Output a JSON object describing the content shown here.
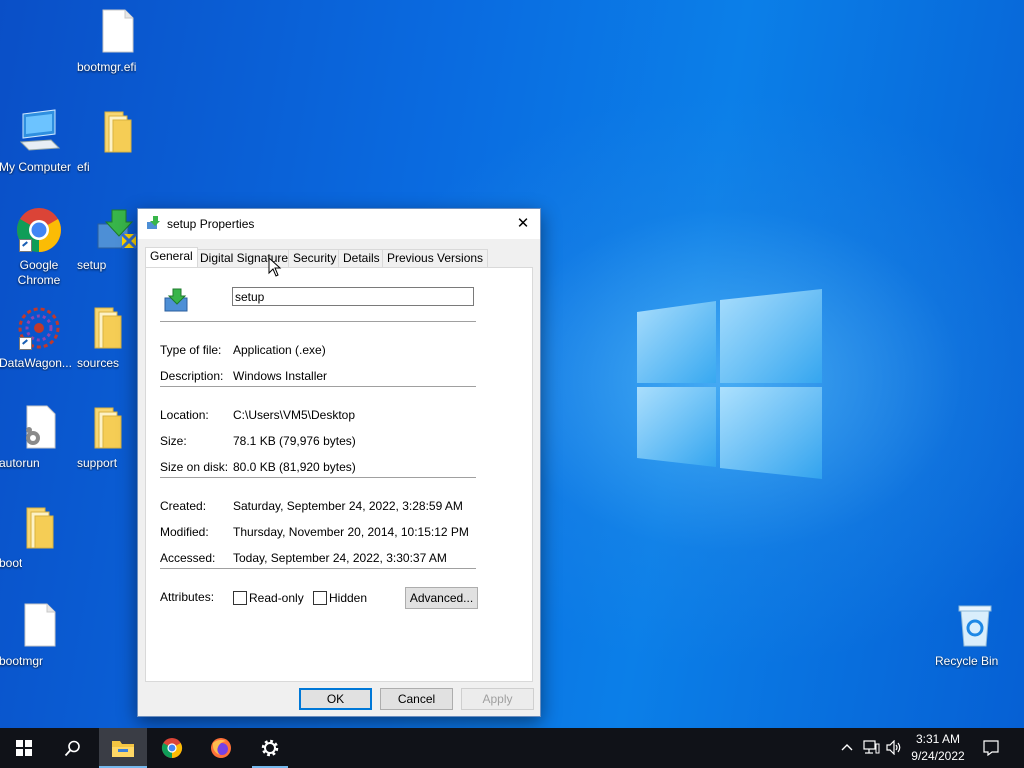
{
  "desktop": {
    "icons": [
      {
        "label": "bootmgr.efi"
      },
      {
        "label": "My Computer"
      },
      {
        "label": "efi"
      },
      {
        "label": "Google Chrome"
      },
      {
        "label": "setup"
      },
      {
        "label": "DataWagon..."
      },
      {
        "label": "sources"
      },
      {
        "label": "autorun"
      },
      {
        "label": "support"
      },
      {
        "label": "boot"
      },
      {
        "label": "bootmgr"
      },
      {
        "label": "Recycle Bin"
      }
    ]
  },
  "dialog": {
    "title": "setup Properties",
    "close_glyph": "✕",
    "tabs": [
      {
        "label": "General",
        "active": true
      },
      {
        "label": "Digital Signatures"
      },
      {
        "label": "Security"
      },
      {
        "label": "Details"
      },
      {
        "label": "Previous Versions"
      }
    ],
    "file_name": "setup",
    "fields": {
      "type_label": "Type of file:",
      "type_value": "Application (.exe)",
      "desc_label": "Description:",
      "desc_value": "Windows Installer",
      "location_label": "Location:",
      "location_value": "C:\\Users\\VM5\\Desktop",
      "size_label": "Size:",
      "size_value": "78.1 KB (79,976 bytes)",
      "size_disk_label": "Size on disk:",
      "size_disk_value": "80.0 KB (81,920 bytes)",
      "created_label": "Created:",
      "created_value": "Saturday, September 24, 2022, 3:28:59 AM",
      "modified_label": "Modified:",
      "modified_value": "Thursday, November 20, 2014, 10:15:12 PM",
      "accessed_label": "Accessed:",
      "accessed_value": "Today, September 24, 2022, 3:30:37 AM",
      "attributes_label": "Attributes:"
    },
    "attributes": {
      "readonly_label": "Read-only",
      "readonly_checked": false,
      "hidden_label": "Hidden",
      "hidden_checked": false,
      "advanced_label": "Advanced..."
    },
    "buttons": {
      "ok": "OK",
      "cancel": "Cancel",
      "apply": "Apply"
    }
  },
  "taskbar": {
    "time": "3:31 AM",
    "date": "9/24/2022"
  },
  "colors": {
    "accent": "#0078d7",
    "taskbar": "#101218"
  }
}
